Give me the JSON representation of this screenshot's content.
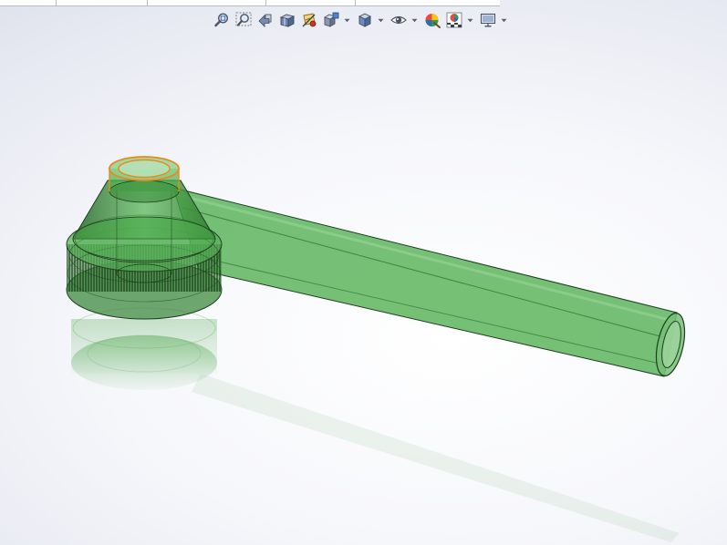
{
  "tabs": [
    "",
    "",
    "",
    ""
  ],
  "toolbar": {
    "items": [
      {
        "icon": "zoom-to-fit-icon"
      },
      {
        "icon": "zoom-to-area-icon"
      },
      {
        "icon": "previous-view-icon"
      },
      {
        "icon": "section-view-icon"
      },
      {
        "icon": "dynamic-annotation-view-icon"
      },
      {
        "icon": "view-orientation-icon",
        "dropdown": true
      },
      {
        "icon": "display-style-icon",
        "dropdown": true
      },
      {
        "icon": "hide-show-items-icon",
        "dropdown": true
      },
      {
        "icon": "edit-appearance-icon"
      },
      {
        "icon": "apply-scene-icon",
        "dropdown": true
      },
      {
        "icon": "view-settings-icon",
        "dropdown": true
      }
    ]
  },
  "colors": {
    "model_fill": "#4fae4f",
    "model_edge": "#1d3f1d",
    "selected_edge": "#e98a1c",
    "background_center": "#ffffff",
    "background_edge": "#d3d8e4"
  }
}
